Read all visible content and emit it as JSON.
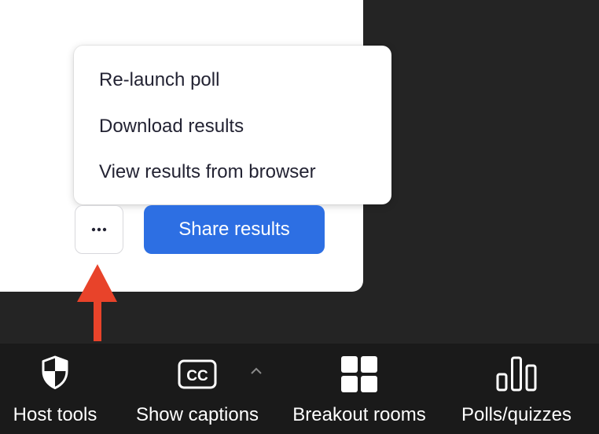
{
  "menu": {
    "items": [
      {
        "label": "Re-launch poll"
      },
      {
        "label": "Download results"
      },
      {
        "label": "View results from browser"
      }
    ]
  },
  "buttons": {
    "more_icon": "ellipsis-icon",
    "share_label": "Share results"
  },
  "toolbar": {
    "items": [
      {
        "label": "Host tools",
        "icon": "shield-icon"
      },
      {
        "label": "Show captions",
        "icon": "cc-icon"
      },
      {
        "label": "Breakout rooms",
        "icon": "grid-icon"
      },
      {
        "label": "Polls/quizzes",
        "icon": "bar-chart-icon"
      }
    ]
  },
  "colors": {
    "primary": "#2d6fe3",
    "arrow": "#e8432a",
    "toolbar_bg": "#1a1a1a",
    "backdrop": "#242424"
  }
}
